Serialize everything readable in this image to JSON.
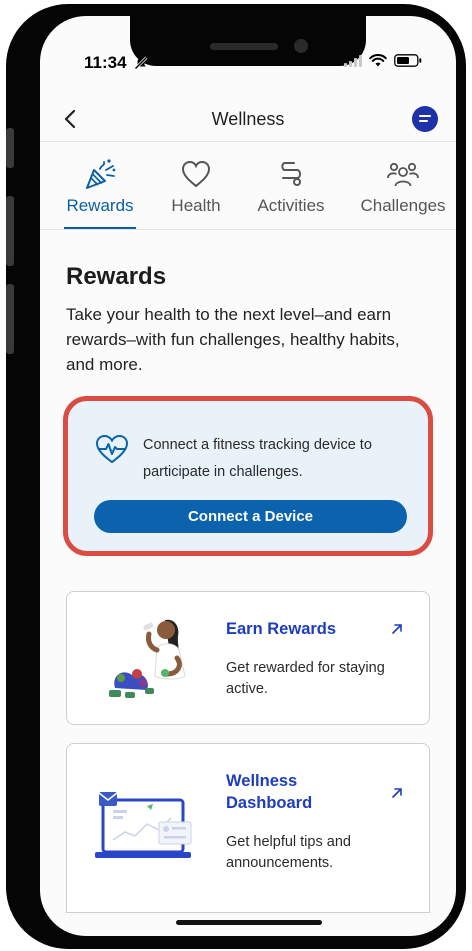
{
  "status_bar": {
    "time": "11:34"
  },
  "nav": {
    "title": "Wellness"
  },
  "tabs": [
    {
      "label": "Rewards",
      "icon": "party-popper-icon",
      "active": true
    },
    {
      "label": "Health",
      "icon": "heart-outline-icon",
      "active": false
    },
    {
      "label": "Activities",
      "icon": "route-icon",
      "active": false
    },
    {
      "label": "Challenges",
      "icon": "group-icon",
      "active": false
    }
  ],
  "rewards": {
    "title": "Rewards",
    "intro": "Take your health to the next level–and earn rewards–with fun challenges, healthy habits, and more."
  },
  "connect_card": {
    "text": "Connect a fitness tracking device to participate in challenges.",
    "button_label": "Connect a Device"
  },
  "cards": [
    {
      "title": "Earn Rewards",
      "description": "Get rewarded for staying active."
    },
    {
      "title": "Wellness Dashboard",
      "description": "Get helpful tips and announcements."
    }
  ],
  "colors": {
    "accent": "#0b5fa8",
    "button": "#0b63ad",
    "highlight_border": "#d94d43",
    "card_title": "#1c3dbf",
    "chat_badge": "#1e31a8"
  }
}
